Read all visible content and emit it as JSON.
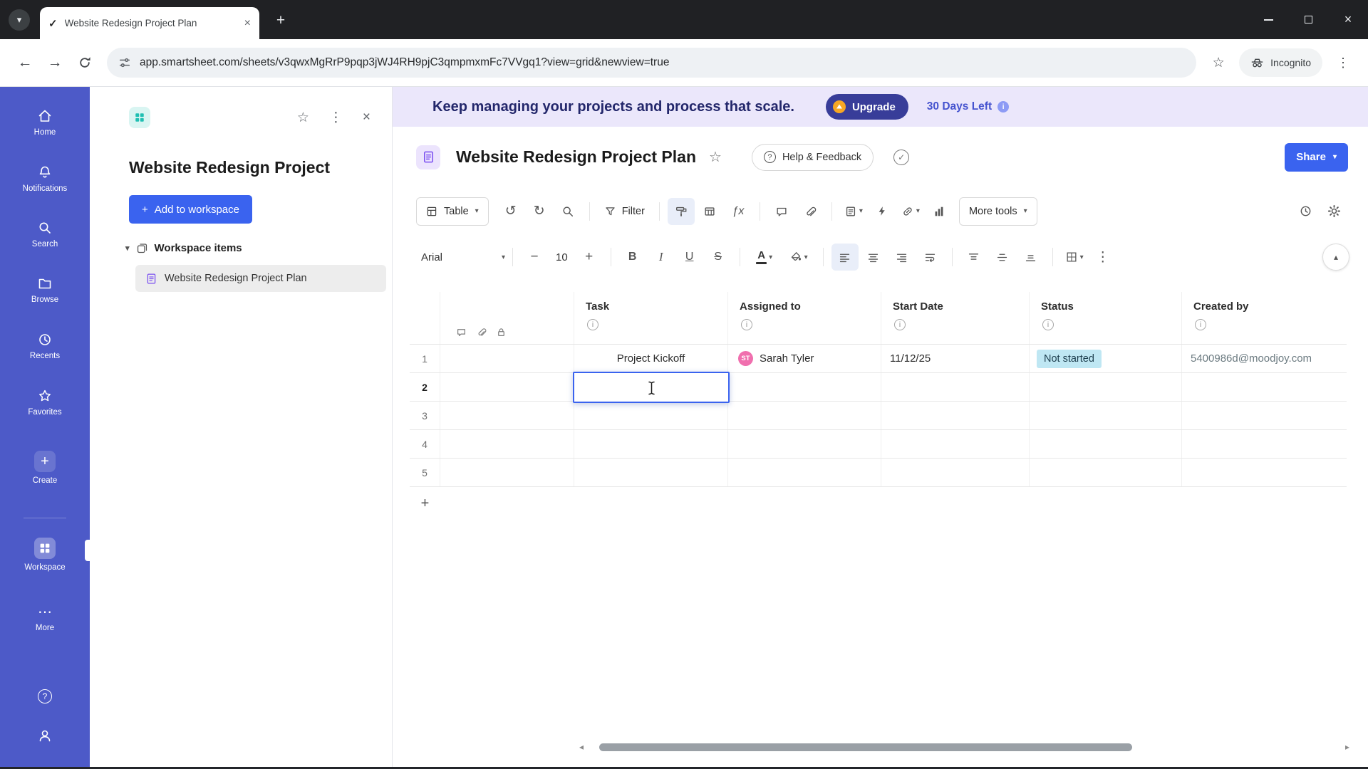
{
  "icons": {
    "chevron_down": "▾",
    "chevron_up": "▴",
    "star": "☆",
    "kebab": "⋮",
    "ellipsis": "⋯",
    "close": "×",
    "plus": "+",
    "minus": "−",
    "undo": "↺",
    "redo": "↻",
    "back": "←",
    "forward": "→",
    "check": "✓",
    "fx": "ƒx",
    "info": "i",
    "question": "?",
    "arrow_left": "◂",
    "arrow_right": "▸"
  },
  "colors": {
    "accent_blue": "#3a63ef",
    "nav_blue": "#4d5ac8",
    "banner_bg": "#ebe7fb",
    "banner_text": "#23276b",
    "upgrade_bg": "#383d99",
    "status_not_started_bg": "#bfe7f3",
    "avatar_pink": "#f06fae",
    "panel_icon_teal": "#1fbfb2",
    "sheet_icon_purple": "#7a4ff0"
  },
  "browser": {
    "tab": {
      "title": "Website Redesign Project Plan"
    },
    "url": "app.smartsheet.com/sheets/v3qwxMgRrP9pqp3jWJ4RH9pjC3qmpmxmFc7VVgq1?view=grid&newview=true",
    "incognito_label": "Incognito"
  },
  "nav": {
    "items": [
      {
        "label": "Home"
      },
      {
        "label": "Notifications"
      },
      {
        "label": "Search"
      },
      {
        "label": "Browse"
      },
      {
        "label": "Recents"
      },
      {
        "label": "Favorites"
      },
      {
        "label": "Create"
      },
      {
        "label": "Workspace"
      },
      {
        "label": "More"
      }
    ]
  },
  "panel": {
    "title": "Website Redesign Project",
    "add_label": "Add to workspace",
    "section_label": "Workspace items",
    "item_label": "Website Redesign Project Plan"
  },
  "banner": {
    "message": "Keep managing your projects and process that scale.",
    "upgrade": "Upgrade",
    "days_left": "30 Days Left"
  },
  "sheet": {
    "title": "Website Redesign Project Plan",
    "help_feedback": "Help & Feedback",
    "share": "Share"
  },
  "toolbar": {
    "table": "Table",
    "filter": "Filter",
    "more_tools": "More tools"
  },
  "format": {
    "font": "Arial",
    "size": "10",
    "bold": "B",
    "italic": "I",
    "underline": "U",
    "strike": "S",
    "color": "A"
  },
  "grid": {
    "columns": [
      {
        "label": "Task"
      },
      {
        "label": "Assigned to"
      },
      {
        "label": "Start Date"
      },
      {
        "label": "Status"
      },
      {
        "label": "Created by"
      }
    ],
    "rows": [
      {
        "num": "1",
        "task": "Project Kickoff",
        "assignee_initials": "ST",
        "assignee": "Sarah Tyler",
        "start": "11/12/25",
        "status": "Not started",
        "created_by": "5400986d@moodjoy.com"
      },
      {
        "num": "2"
      },
      {
        "num": "3"
      },
      {
        "num": "4"
      },
      {
        "num": "5"
      }
    ]
  }
}
